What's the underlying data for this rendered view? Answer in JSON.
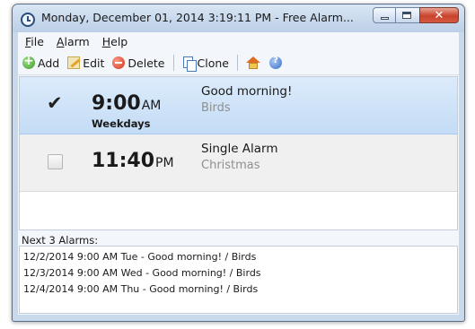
{
  "window": {
    "title": "Monday, December 01, 2014 3:19:11 PM - Free Alarm..."
  },
  "menu": [
    {
      "accel": "F",
      "rest": "ile"
    },
    {
      "accel": "A",
      "rest": "larm"
    },
    {
      "accel": "H",
      "rest": "elp"
    }
  ],
  "toolbar": {
    "add": "Add",
    "edit": "Edit",
    "delete": "Delete",
    "clone": "Clone"
  },
  "alarms": [
    {
      "checked": true,
      "time": "9:00",
      "ampm": "AM",
      "repeat": "Weekdays",
      "label": "Good morning!",
      "sound": "Birds"
    },
    {
      "checked": false,
      "time": "11:40",
      "ampm": "PM",
      "repeat": "",
      "label": "Single Alarm",
      "sound": "Christmas"
    }
  ],
  "next_alarms": {
    "heading": "Next 3 Alarms:",
    "items": [
      "12/2/2014 9:00 AM Tue - Good morning! / Birds",
      "12/3/2014 9:00 AM Wed - Good morning! / Birds",
      "12/4/2014 9:00 AM Thu - Good morning! / Birds"
    ]
  },
  "colors": {
    "selection": "#c4dcf5",
    "close_button": "#c8432c"
  }
}
